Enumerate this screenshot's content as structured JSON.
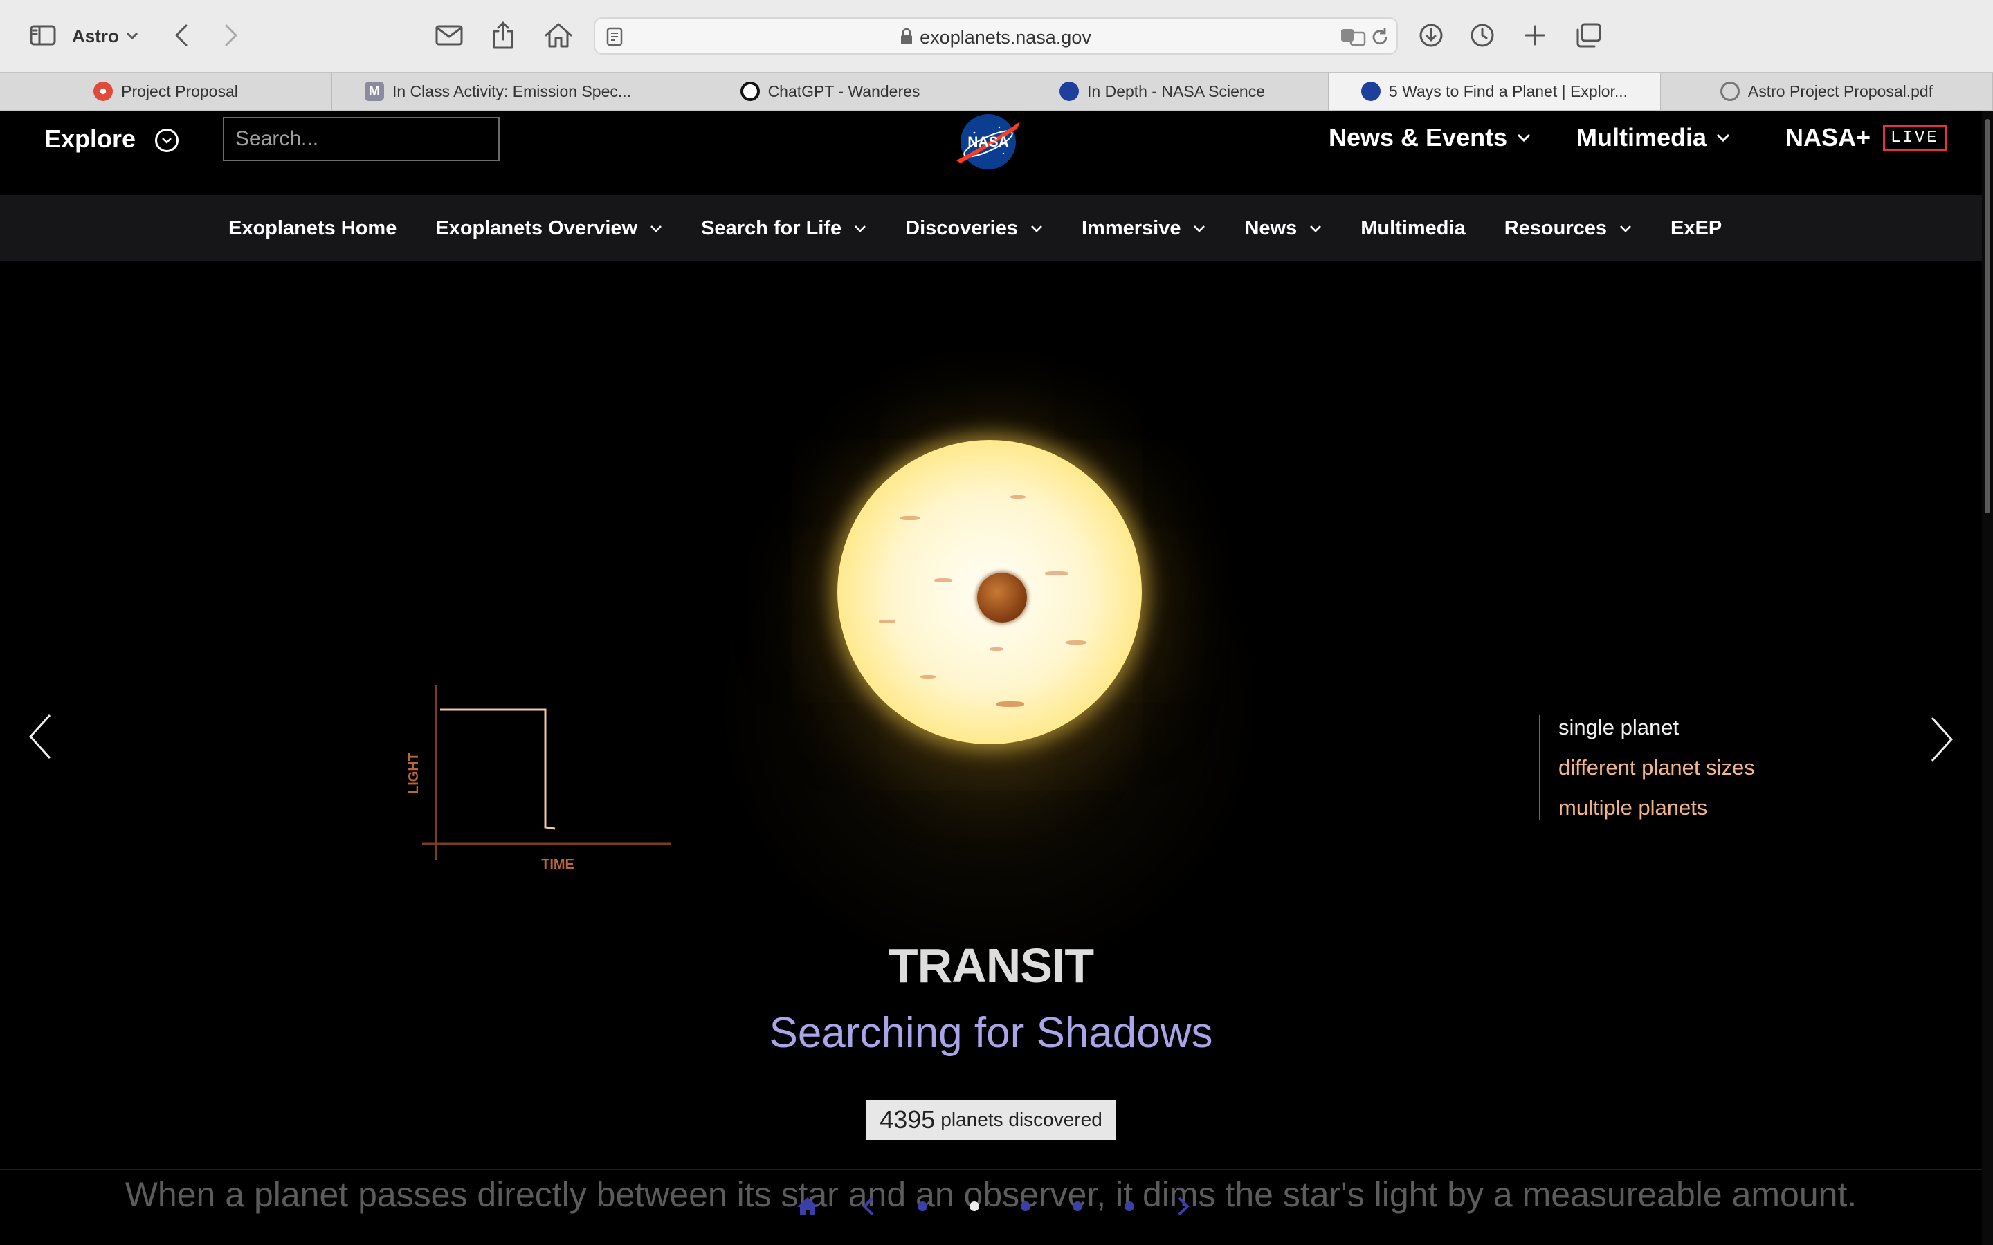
{
  "browser": {
    "profile": "Astro",
    "url": "exoplanets.nasa.gov",
    "tabs": [
      {
        "title": "Project Proposal",
        "favicon_color": "#e04a3a",
        "active": false
      },
      {
        "title": "In Class Activity: Emission Spec...",
        "favicon_color": "#8a8aa0",
        "active": false
      },
      {
        "title": "ChatGPT - Wanderes",
        "favicon_color": "#111111",
        "active": false
      },
      {
        "title": "In Depth - NASA Science",
        "favicon_color": "#1f3f9c",
        "active": false
      },
      {
        "title": "5 Ways to Find a Planet | Explor...",
        "favicon_color": "#1f3f9c",
        "active": true
      },
      {
        "title": "Astro Project Proposal.pdf",
        "favicon_color": "#777777",
        "active": false
      }
    ]
  },
  "site": {
    "explore": "Explore",
    "search_placeholder": "Search...",
    "logo_text": "NASA",
    "top_nav": {
      "news_events": "News & Events",
      "multimedia": "Multimedia",
      "nasa_plus": "NASA+",
      "live": "LIVE"
    },
    "sub_nav": [
      {
        "label": "Exoplanets Home",
        "dropdown": false
      },
      {
        "label": "Exoplanets Overview",
        "dropdown": true
      },
      {
        "label": "Search for Life",
        "dropdown": true
      },
      {
        "label": "Discoveries",
        "dropdown": true
      },
      {
        "label": "Immersive",
        "dropdown": true
      },
      {
        "label": "News",
        "dropdown": true
      },
      {
        "label": "Multimedia",
        "dropdown": false
      },
      {
        "label": "Resources",
        "dropdown": true
      },
      {
        "label": "ExEP",
        "dropdown": false
      }
    ]
  },
  "hero": {
    "graph": {
      "y_label": "LIGHT",
      "x_label": "TIME"
    },
    "options": [
      {
        "label": "single planet",
        "active": true
      },
      {
        "label": "different planet sizes",
        "active": false
      },
      {
        "label": "multiple planets",
        "active": false
      }
    ],
    "title": "TRANSIT",
    "subtitle": "Searching for Shadows",
    "count": "4395",
    "count_label": "planets discovered",
    "body": "When a planet passes directly between its star and an observer, it dims the star's light by a measureable amount.",
    "active_dot": 1
  },
  "colors": {
    "accent_orange": "#f3b585",
    "subtitle_lavender": "#a9a5e8",
    "live_red": "#e0353a",
    "nav_dot": "#3b3fa8"
  }
}
